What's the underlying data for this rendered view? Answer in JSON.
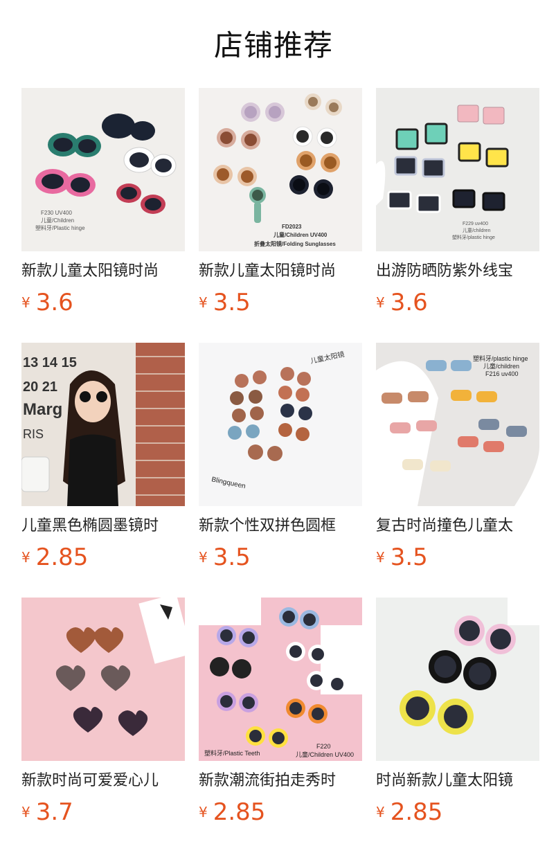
{
  "page_title": "店铺推荐",
  "currency_symbol": "¥",
  "accent_price_color": "#e5531f",
  "products": [
    {
      "name": "新款儿童太阳镜时尚",
      "price": "3.6",
      "image_text": [
        "F230 UV400",
        "儿童/Children",
        "塑料牙/Plastic hinge"
      ]
    },
    {
      "name": "新款儿童太阳镜时尚",
      "price": "3.5",
      "image_text": [
        "FD2023",
        "儿童/Children UV400",
        "折叠太阳镜/Folding Sunglasses"
      ]
    },
    {
      "name": "出游防晒防紫外线宝",
      "price": "3.6",
      "image_text": [
        "F229 uv400",
        "儿童/children",
        "塑料牙/plastic hinge"
      ]
    },
    {
      "name": "儿童黑色椭圆墨镜时",
      "price": "2.85",
      "image_text": [
        "13 14 15",
        "20 21",
        "Marg",
        "RIS"
      ]
    },
    {
      "name": "新款个性双拼色圆框",
      "price": "3.5",
      "image_text": [
        "儿童太阳镜",
        "Blingqueen"
      ]
    },
    {
      "name": "复古时尚撞色儿童太",
      "price": "3.5",
      "image_text": [
        "塑料牙/plastic hinge",
        "儿童/children",
        "F216 uv400"
      ]
    },
    {
      "name": "新款时尚可爱爱心儿",
      "price": "3.7",
      "image_text": []
    },
    {
      "name": "新款潮流街拍走秀时",
      "price": "2.85",
      "image_text": [
        "F220",
        "塑料牙/Plastic Teeth",
        "儿童/Children UV400"
      ]
    },
    {
      "name": "时尚新款儿童太阳镜",
      "price": "2.85",
      "image_text": []
    }
  ]
}
